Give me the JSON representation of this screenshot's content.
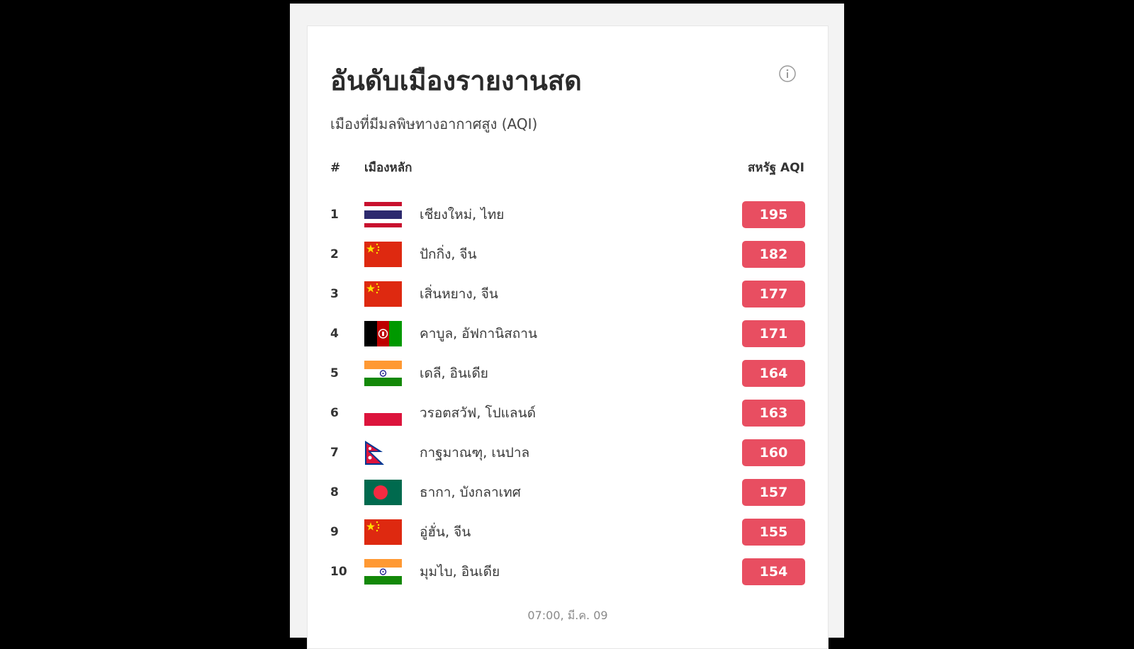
{
  "ranking": {
    "title": "อันดับเมืองรายงานสด",
    "subtitle": "เมืองที่มีมลพิษทางอากาศสูง (AQI)",
    "info_icon": "info-icon",
    "columns": {
      "rank": "#",
      "city": "เมืองหลัก",
      "aqi": "สหรัฐ AQI"
    },
    "aqi_badge_color": "#e84e61",
    "rows": [
      {
        "rank": "1",
        "city": "เชียงใหม่, ไทย",
        "flag": "thailand-flag",
        "aqi": "195"
      },
      {
        "rank": "2",
        "city": "ปักกิ่ง, จีน",
        "flag": "china-flag",
        "aqi": "182"
      },
      {
        "rank": "3",
        "city": "เสิ่นหยาง, จีน",
        "flag": "china-flag",
        "aqi": "177"
      },
      {
        "rank": "4",
        "city": "คาบูล, อัฟกานิสถาน",
        "flag": "afghanistan-flag",
        "aqi": "171"
      },
      {
        "rank": "5",
        "city": "เดลี, อินเดีย",
        "flag": "india-flag",
        "aqi": "164"
      },
      {
        "rank": "6",
        "city": "วรอตสวัฟ, โปแลนด์",
        "flag": "poland-flag",
        "aqi": "163"
      },
      {
        "rank": "7",
        "city": "กาฐมาณฑุ, เนปาล",
        "flag": "nepal-flag",
        "aqi": "160"
      },
      {
        "rank": "8",
        "city": "ธากา, บังกลาเทศ",
        "flag": "bangladesh-flag",
        "aqi": "157"
      },
      {
        "rank": "9",
        "city": "อู่ฮั่น, จีน",
        "flag": "china-flag",
        "aqi": "155"
      },
      {
        "rank": "10",
        "city": "มุมไบ, อินเดีย",
        "flag": "india-flag",
        "aqi": "154"
      }
    ],
    "timestamp": "07:00, มี.ค. 09"
  }
}
